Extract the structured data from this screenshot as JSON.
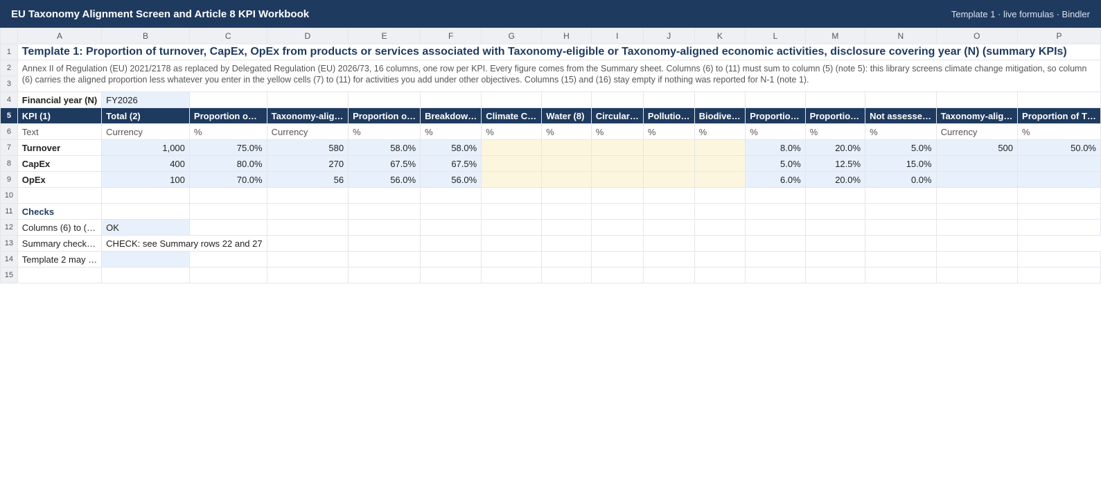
{
  "app": {
    "title": "EU Taxonomy Alignment Screen and Article 8 KPI Workbook",
    "meta": "Template 1 · live formulas · Bindler"
  },
  "columns": [
    "A",
    "B",
    "C",
    "D",
    "E",
    "F",
    "G",
    "H",
    "I",
    "J",
    "K",
    "L",
    "M",
    "N",
    "O",
    "P"
  ],
  "rows": {
    "r1": "Template 1: Proportion of turnover, CapEx, OpEx from products or services associated with Taxonomy-eligible or Taxonomy-aligned economic activities, disclosure covering year (N) (summary KPIs)",
    "r2": "Annex II of Regulation (EU) 2021/2178 as replaced by Delegated Regulation (EU) 2026/73, 16 columns, one row per KPI. Every figure comes from the Summary sheet. Columns (6) to (11) must sum to column (5) (note 5): this library screens climate change mitigation, so column (6) carries the aligned proportion less whatever you enter in the yellow cells (7) to (11) for activities you add under other objectives. Columns (15) and (16) stay empty if nothing was reported for N-1 (note 1).",
    "fy_label": "Financial year (N)",
    "fy_value": "FY2026"
  },
  "headers": [
    "KPI (1)",
    "Total (2)",
    "Proportion o…",
    "Taxonomy-alig…",
    "Proportion o…",
    "Breakdow…",
    "Climate C…",
    "Water (8)",
    "Circular…",
    "Pollutio…",
    "Biodive…",
    "Proportio…",
    "Proportio…",
    "Not assesse…",
    "Taxonomy-alig…",
    "Proportion of T…"
  ],
  "units": [
    "Text",
    "Currency",
    "%",
    "Currency",
    "%",
    "%",
    "%",
    "%",
    "%",
    "%",
    "%",
    "%",
    "%",
    "%",
    "Currency",
    "%"
  ],
  "kpis": [
    {
      "name": "Turnover",
      "cells": [
        "1,000",
        "75.0%",
        "580",
        "58.0%",
        "58.0%",
        "",
        "",
        "",
        "",
        "",
        "8.0%",
        "20.0%",
        "5.0%",
        "500",
        "50.0%"
      ]
    },
    {
      "name": "CapEx",
      "cells": [
        "400",
        "80.0%",
        "270",
        "67.5%",
        "67.5%",
        "",
        "",
        "",
        "",
        "",
        "5.0%",
        "12.5%",
        "15.0%",
        "",
        ""
      ]
    },
    {
      "name": "OpEx",
      "cells": [
        "100",
        "70.0%",
        "56",
        "56.0%",
        "56.0%",
        "",
        "",
        "",
        "",
        "",
        "6.0%",
        "20.0%",
        "0.0%",
        "",
        ""
      ]
    }
  ],
  "checks": {
    "title": "Checks",
    "r12_label": "Columns (6) to (…",
    "r12_value": "OK",
    "r13_label": "Summary check…",
    "r13_value": "CHECK: see Summary rows 22 and 27",
    "r14_label": "Template 2 may …",
    "r14_value": ""
  }
}
